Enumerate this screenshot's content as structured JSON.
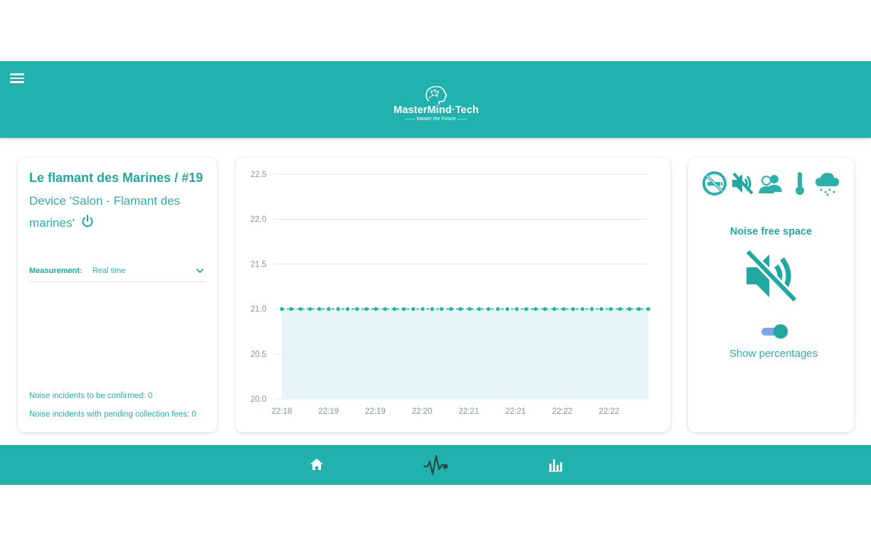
{
  "header": {
    "logo_name": "MasterMind·Tech",
    "logo_tagline": "—— Master the Future ——"
  },
  "device_panel": {
    "location_title": "Le flamant des Marines / #19",
    "device_title": "Device 'Salon - Flamant des marines'",
    "measurement_label": "Measurement:",
    "measurement_value": "Real time",
    "incidents_to_confirm": "Noise incidents to be confirmed: 0",
    "incidents_pending_fees": "Noise incidents with pending collection fees: 0"
  },
  "status_panel": {
    "icons": [
      "no-smoking-icon",
      "noise-free-icon",
      "people-icon",
      "thermometer-icon",
      "rain-cloud-icon"
    ],
    "status_title": "Noise free space",
    "status_icon": "volume-off-icon",
    "toggle_label": "Show percentages",
    "toggle_on": true
  },
  "bottom_nav": {
    "items": [
      "home-icon",
      "activity-pulse-icon",
      "bar-chart-icon"
    ],
    "active": "activity-pulse-icon"
  },
  "colors": {
    "primary": "#21b2ad",
    "text_teal": "#2bb0ab",
    "area_fill": "#e6f5f4",
    "active_nav_icon": "#2d4a4a"
  },
  "chart_data": {
    "type": "area",
    "x_tick_labels": [
      "22:18",
      "22:19",
      "22:19",
      "22:20",
      "22:21",
      "22:21",
      "22:22",
      "22:22"
    ],
    "y_ticks": [
      "20.0",
      "20.5",
      "21.0",
      "21.5",
      "22.0",
      "22.5"
    ],
    "ylim": [
      20.0,
      22.5
    ],
    "grid": true,
    "series": [
      {
        "values": [
          21,
          21,
          21,
          21,
          21,
          21,
          21,
          21,
          21,
          21,
          21,
          21,
          21,
          21,
          21,
          21,
          21,
          21,
          21,
          21,
          21,
          21,
          21,
          21,
          21,
          21,
          21,
          21,
          21,
          21,
          21,
          21,
          21,
          21,
          21,
          21,
          21,
          21,
          21,
          21
        ]
      }
    ]
  }
}
